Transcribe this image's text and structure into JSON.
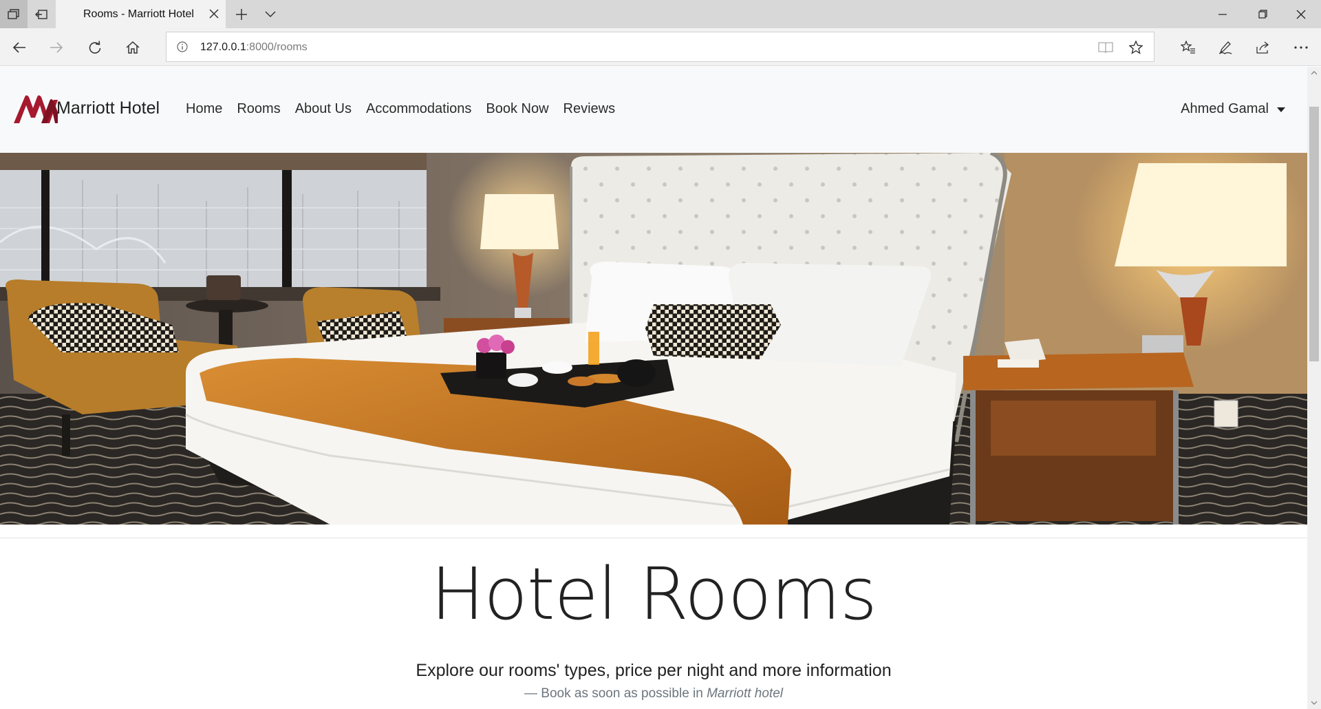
{
  "browser": {
    "tab_title": "Rooms - Marriott Hotel",
    "url_host": "127.0.0.1",
    "url_rest": ":8000/rooms"
  },
  "navbar": {
    "brand": "Marriott Hotel",
    "links": [
      {
        "label": "Home"
      },
      {
        "label": "Rooms"
      },
      {
        "label": "About Us"
      },
      {
        "label": "Accommodations"
      },
      {
        "label": "Book Now"
      },
      {
        "label": "Reviews"
      }
    ],
    "user": "Ahmed Gamal"
  },
  "page": {
    "heading": "Hotel Rooms",
    "lead": "Explore our rooms' types, price per night and more information",
    "footer_prefix": "— Book as soon as possible in ",
    "footer_em": "Marriott hotel"
  },
  "colors": {
    "brand_red": "#a6192e",
    "navbar_bg": "#f8f9fa",
    "bed_throw": "#c8761f"
  },
  "icons": {
    "hero_image": "hotel-room-photo",
    "logo": "marriott-logo"
  }
}
